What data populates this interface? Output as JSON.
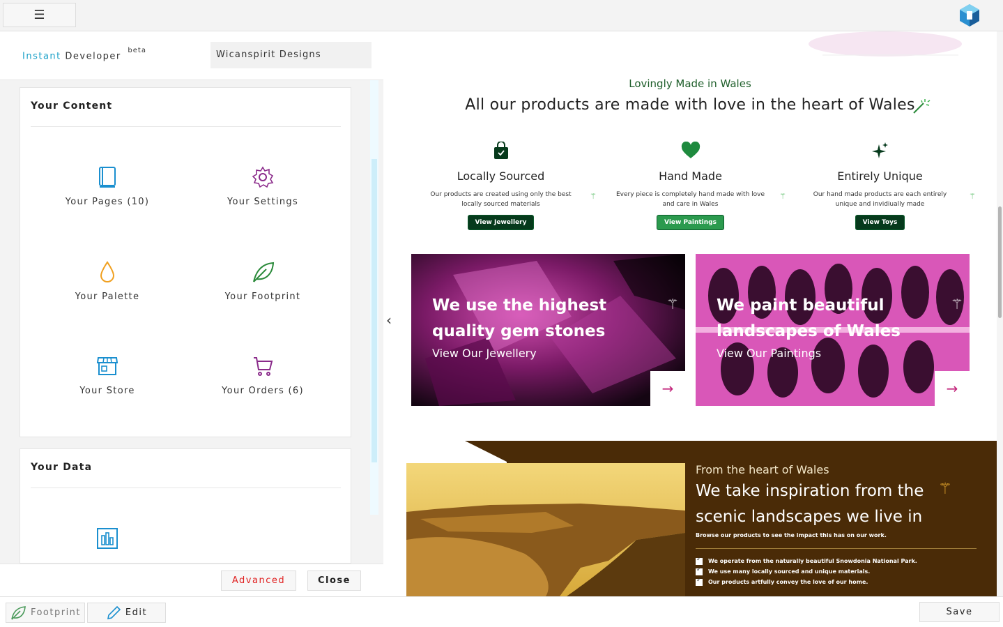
{
  "topbar": {
    "menu_glyph": "☰",
    "logo_icon": "cube-logo-icon"
  },
  "left_panel": {
    "brand_first": "Instant",
    "brand_second": "Developer",
    "brand_tag": "beta",
    "site_name": "Wicanspirit Designs",
    "content_card": {
      "title": "Your Content",
      "tiles": [
        {
          "label": "Your Pages (10)",
          "icon": "book-icon"
        },
        {
          "label": "Your Settings",
          "icon": "gear-icon"
        },
        {
          "label": "Your Palette",
          "icon": "droplet-icon"
        },
        {
          "label": "Your Footprint",
          "icon": "leaf-icon"
        },
        {
          "label": "Your Store",
          "icon": "store-icon"
        },
        {
          "label": "Your Orders (6)",
          "icon": "cart-icon"
        }
      ]
    },
    "data_card": {
      "title": "Your Data",
      "tiles": [
        {
          "icon": "bar-chart-icon"
        }
      ]
    },
    "footer": {
      "advanced_label": "Advanced",
      "close_label": "Close"
    }
  },
  "bottombar": {
    "footprint_label": "Footprint",
    "edit_label": "Edit",
    "save_label": "Save"
  },
  "preview": {
    "kicker": "Lovingly Made in Wales",
    "title": "All our products are made with love in the heart of Wales",
    "features": [
      {
        "icon": "shopping-bag-icon",
        "title": "Locally Sourced",
        "desc": "Our products are created using only the best locally sourced materials",
        "button": "View Jewellery"
      },
      {
        "icon": "heart-icon",
        "title": "Hand Made",
        "desc": "Every piece is completely hand made with love and care in Wales",
        "button": "View Paintings"
      },
      {
        "icon": "sparkle-icon",
        "title": "Entirely Unique",
        "desc": "Our hand made products are each entirely unique and invidiually made",
        "button": "View Toys"
      }
    ],
    "promos": [
      {
        "title": "We use the highest quality gem stones",
        "link": "View Our Jewellery",
        "arrow": "→"
      },
      {
        "title": "We paint beautiful landscapes of Wales",
        "link": "View Our Paintings",
        "arrow": "→"
      }
    ],
    "banner": {
      "kicker": "From the heart of Wales",
      "title": "We take inspiration from the scenic landscapes we live in",
      "subtitle": "Browse our products to see the impact this has on our work.",
      "items": [
        "We operate from the naturally beautiful Snowdonia National Park.",
        "We use many locally sourced and unique materials.",
        "Our products artfully convey the love of our home."
      ]
    },
    "collapse_glyph": "‹"
  },
  "colors": {
    "accent_blue": "#1aa0c8",
    "brand_green": "#063a1c",
    "banner_brown": "#4a2b07",
    "promo_pink": "#c2247a",
    "danger_red": "#e02020"
  }
}
